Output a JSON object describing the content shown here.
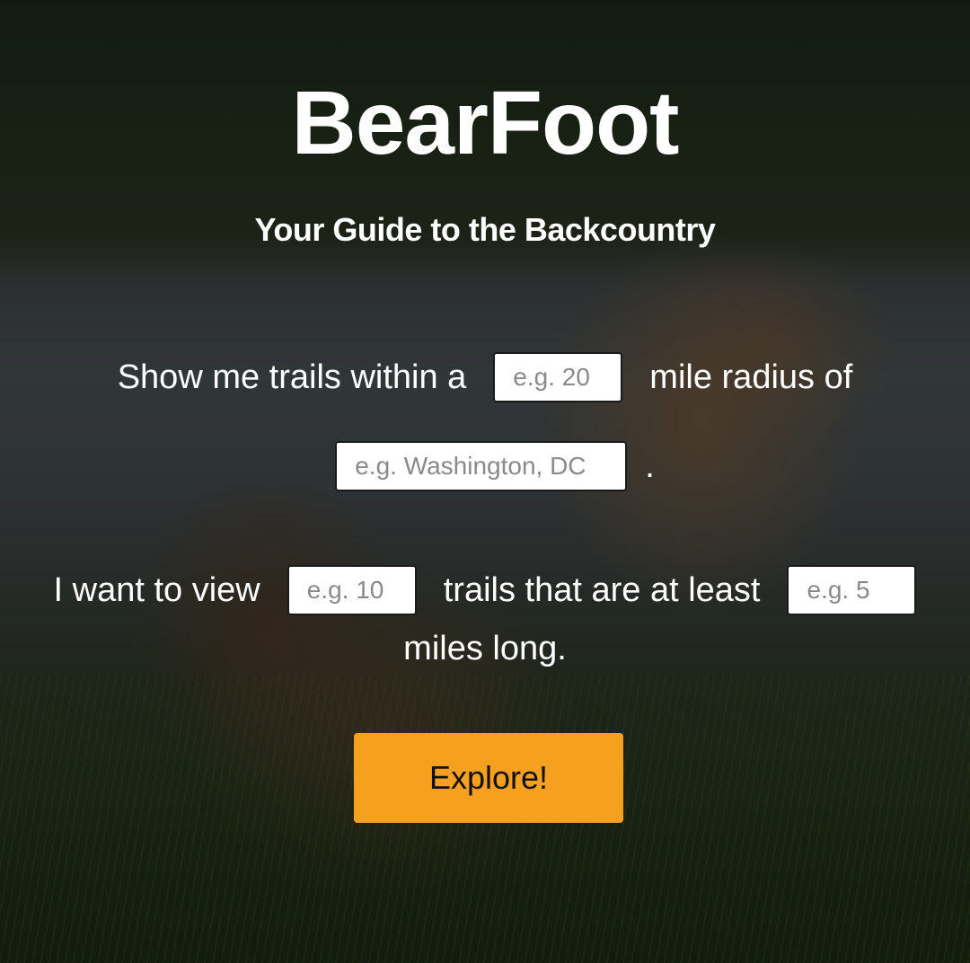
{
  "hero": {
    "title": "BearFoot",
    "subtitle": "Your Guide to the Backcountry"
  },
  "form": {
    "line1_prefix": "Show me trails within a",
    "radius_placeholder": "e.g. 20",
    "line1_suffix": "mile radius of",
    "location_placeholder": "e.g. Washington, DC",
    "line2_suffix": ".",
    "line3_prefix": "I want to view",
    "count_placeholder": "e.g. 10",
    "line3_middle": "trails that are at least",
    "length_placeholder": "e.g. 5",
    "line4_text": "miles long.",
    "submit_label": "Explore!"
  },
  "colors": {
    "accent": "#f6a020",
    "text": "#ffffff"
  }
}
